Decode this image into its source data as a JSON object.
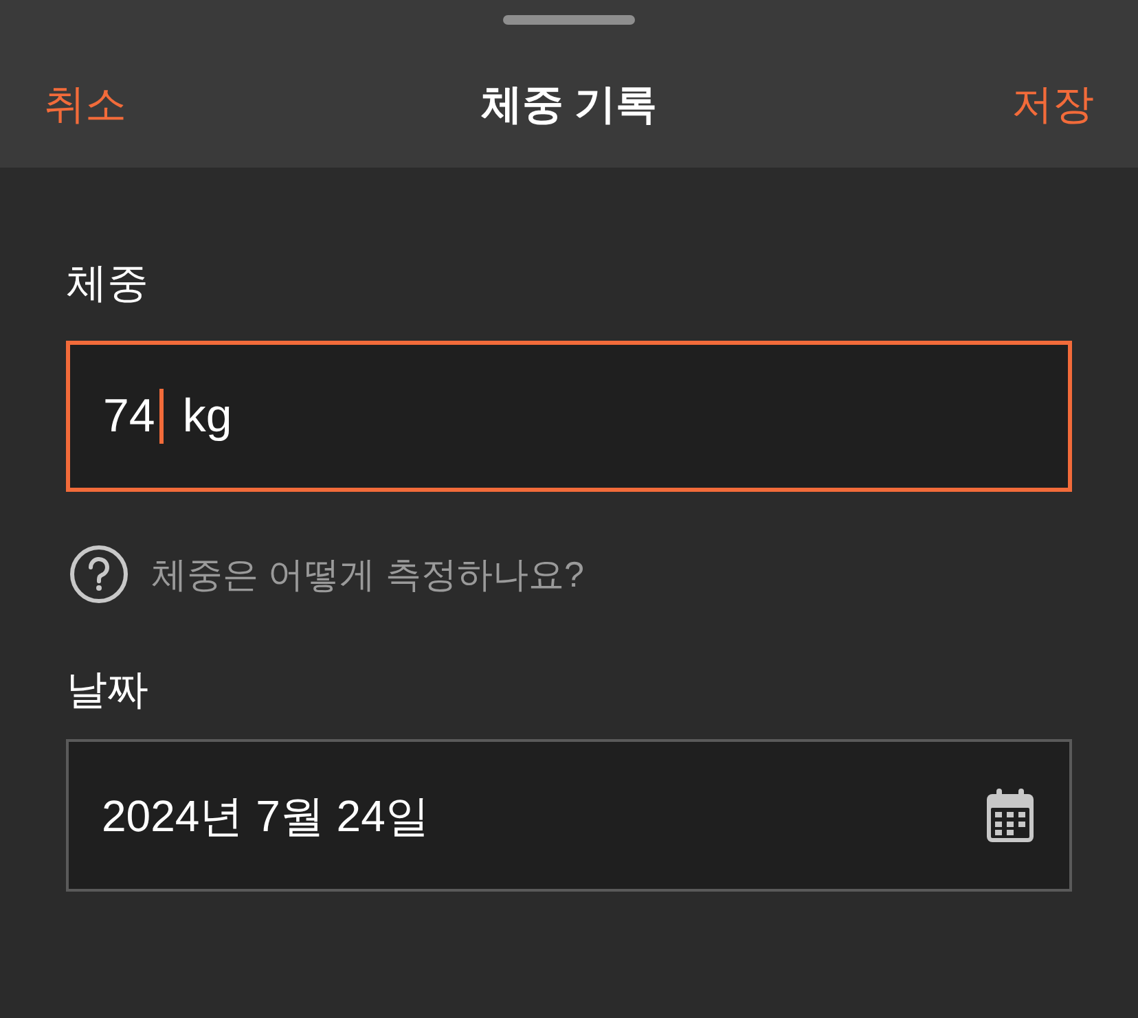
{
  "header": {
    "cancel": "취소",
    "title": "체중 기록",
    "save": "저장"
  },
  "weight": {
    "label": "체중",
    "value": "74",
    "unit": "kg",
    "focused": true
  },
  "help": {
    "text": "체중은 어떻게 측정하나요?"
  },
  "date": {
    "label": "날짜",
    "value": "2024년 7월 24일",
    "focused": false
  }
}
